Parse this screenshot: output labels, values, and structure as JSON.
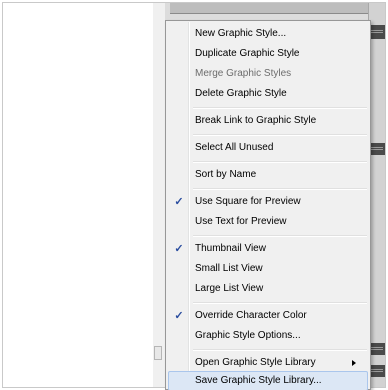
{
  "context_menu": {
    "items": [
      {
        "label": "New Graphic Style...",
        "disabled": false
      },
      {
        "label": "Duplicate Graphic Style",
        "disabled": false
      },
      {
        "label": "Merge Graphic Styles",
        "disabled": true
      },
      {
        "label": "Delete Graphic Style",
        "disabled": false
      },
      {
        "label": "Break Link to Graphic Style",
        "disabled": false
      },
      {
        "label": "Select All Unused",
        "disabled": false
      },
      {
        "label": "Sort by Name",
        "disabled": false
      },
      {
        "label": "Use Square for Preview",
        "disabled": false,
        "checked": true
      },
      {
        "label": "Use Text for Preview",
        "disabled": false
      },
      {
        "label": "Thumbnail View",
        "disabled": false,
        "checked": true
      },
      {
        "label": "Small List View",
        "disabled": false
      },
      {
        "label": "Large List View",
        "disabled": false
      },
      {
        "label": "Override Character Color",
        "disabled": false,
        "checked": true
      },
      {
        "label": "Graphic Style Options...",
        "disabled": false
      },
      {
        "label": "Open Graphic Style Library",
        "disabled": false,
        "has_submenu": true
      },
      {
        "label": "Save Graphic Style Library...",
        "disabled": false,
        "highlighted": true
      }
    ],
    "check_glyph": "✓"
  },
  "colors": {
    "menu_bg": "#f0f0f0",
    "highlight_bg": "#dce7f5",
    "highlight_border": "#aac6ec",
    "check_color": "#2a4d9f",
    "disabled_text": "#6d6d6d"
  }
}
